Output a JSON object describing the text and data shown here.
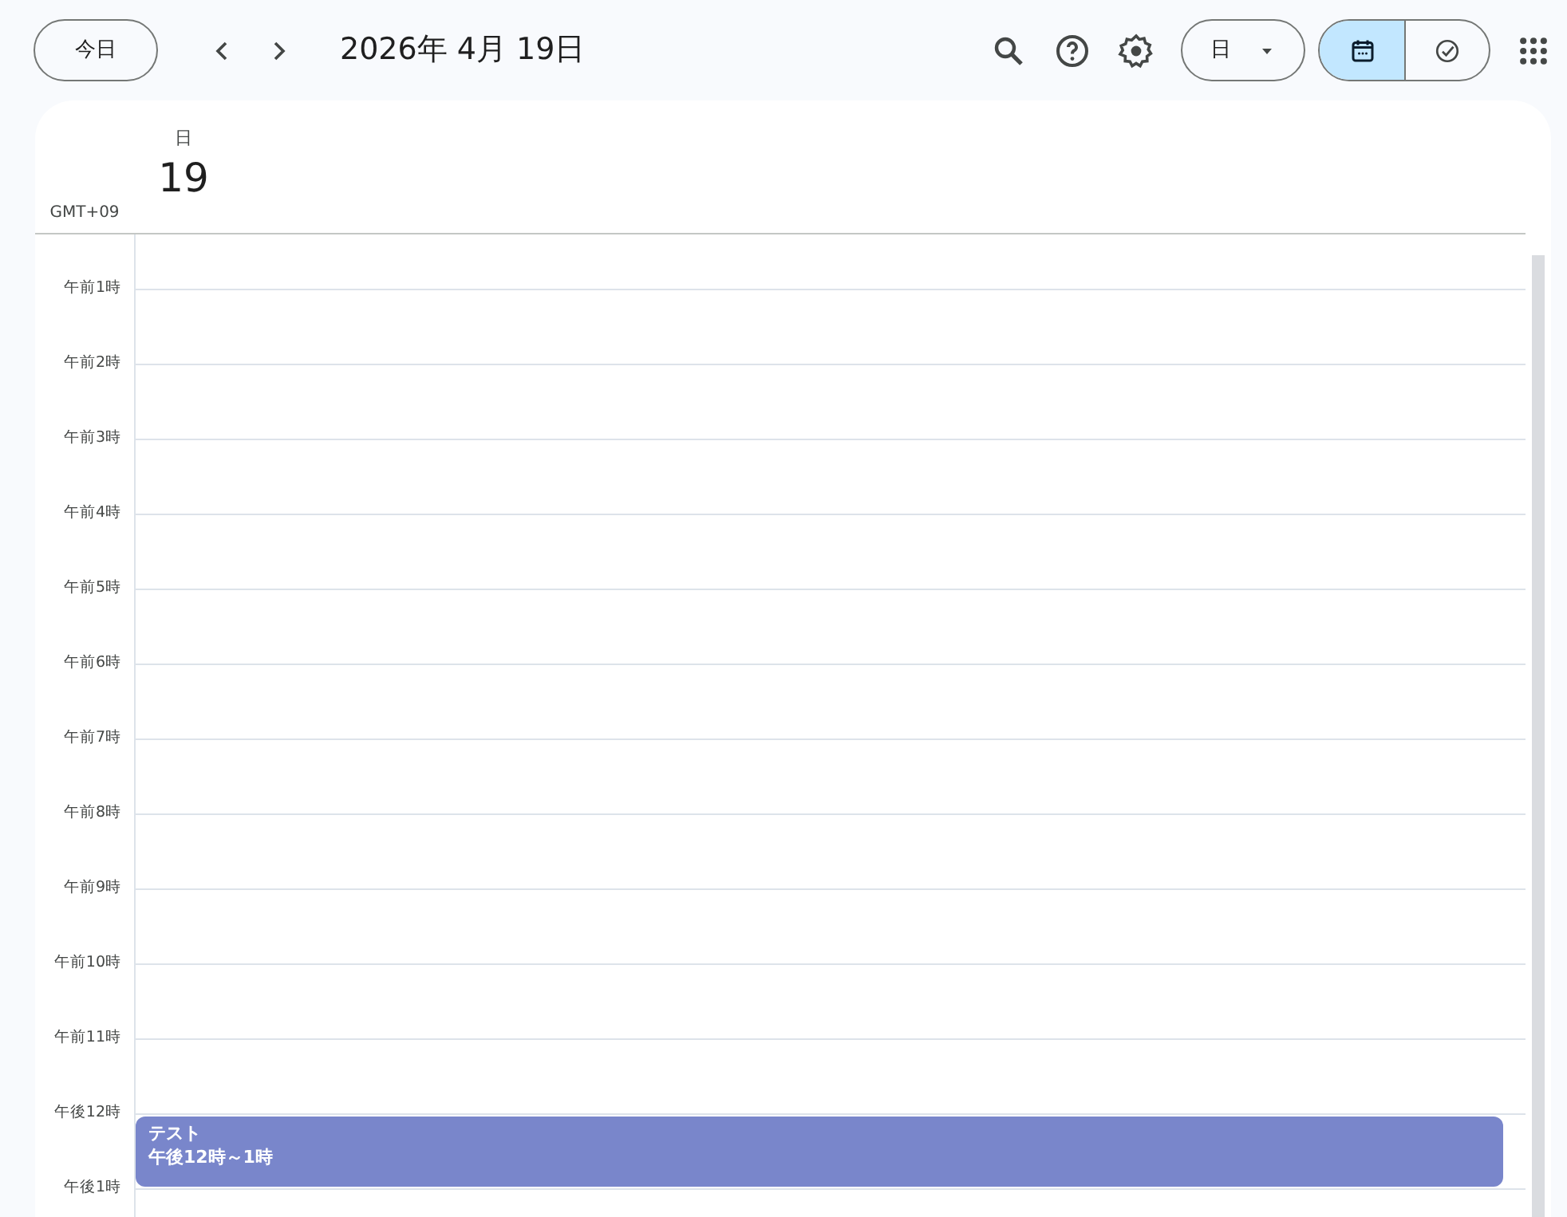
{
  "toolbar": {
    "today_button": "今日",
    "title": "2026年 4月 19日",
    "view_dropdown": "日",
    "view_toggle": [
      {
        "kind": "calendar",
        "selected": true
      },
      {
        "kind": "tasks",
        "selected": false
      }
    ]
  },
  "day_header": {
    "weekday": "日",
    "date": "19"
  },
  "timezone": "GMT+09",
  "hours": [
    {
      "label": "午前1時"
    },
    {
      "label": "午前2時"
    },
    {
      "label": "午前3時"
    },
    {
      "label": "午前4時"
    },
    {
      "label": "午前5時"
    },
    {
      "label": "午前6時"
    },
    {
      "label": "午前7時"
    },
    {
      "label": "午前8時"
    },
    {
      "label": "午前9時"
    },
    {
      "label": "午前10時"
    },
    {
      "label": "午前11時"
    },
    {
      "label": "午後12時",
      "events": [
        {
          "title": "テスト",
          "time": "午後12時～1時",
          "color": "#7986cb"
        }
      ]
    },
    {
      "label": "午後1時"
    }
  ]
}
